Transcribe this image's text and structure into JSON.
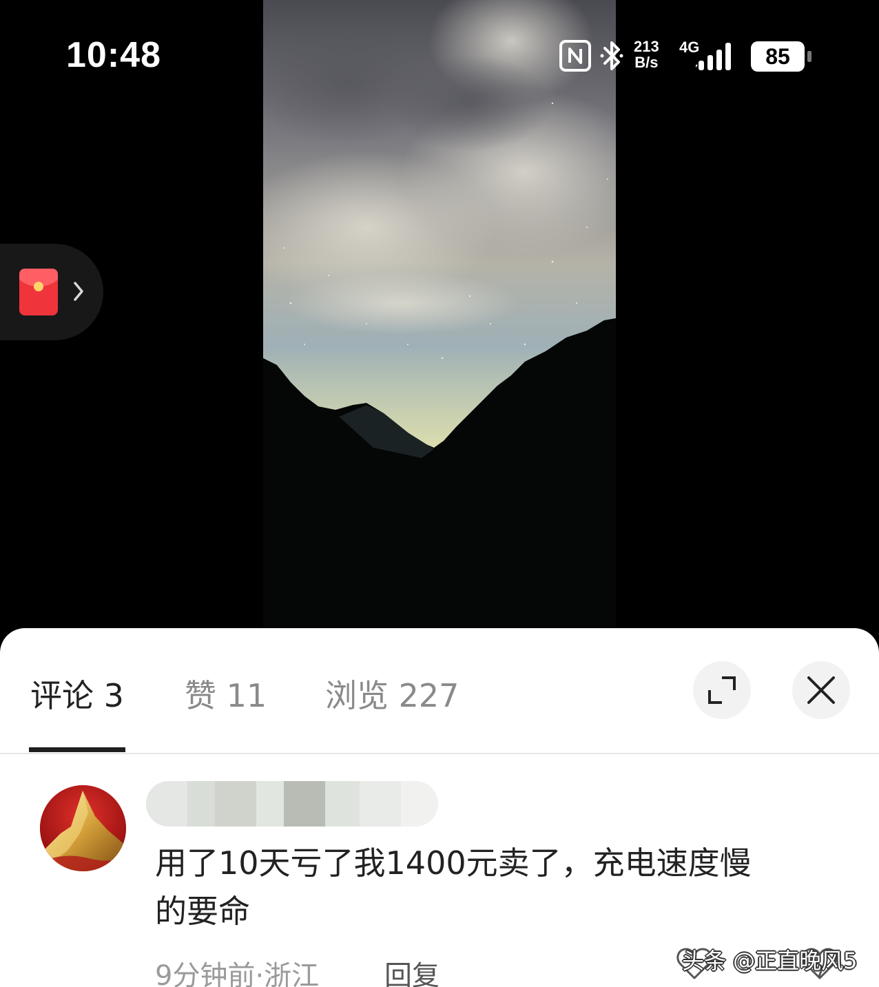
{
  "status_bar": {
    "time": "10:48",
    "net_speed_value": "213",
    "net_speed_unit": "B/s",
    "network_type": "4G",
    "battery_level": "85",
    "icons": [
      "nfc-icon",
      "bluetooth-icon",
      "signal-icon",
      "battery-icon"
    ]
  },
  "media": {
    "photo_icon": "night-sky-mountain-photo",
    "floating_button_icon": "red-envelope-icon"
  },
  "tabs": [
    {
      "label": "评论 3",
      "active": true
    },
    {
      "label": "赞 11",
      "active": false
    },
    {
      "label": "浏览 227",
      "active": false
    }
  ],
  "sheet_actions": {
    "expand_icon": "expand-icon",
    "close_icon": "close-icon"
  },
  "comment": {
    "avatar_icon": "golden-mountain-avatar",
    "username_obscured": true,
    "text_line1": "用了10天亏了我1400元卖了，充电速度慢",
    "text_line2": "的要命",
    "time_location": "9分钟前·浙江",
    "reply_label": "回复"
  },
  "watermark": "头条 @正直晚风5",
  "colors": {
    "background": "#000000",
    "sheet": "#ffffff",
    "active_tab": "#222222",
    "inactive_tab": "#8a8a8a",
    "red_envelope": "#f0343c"
  }
}
